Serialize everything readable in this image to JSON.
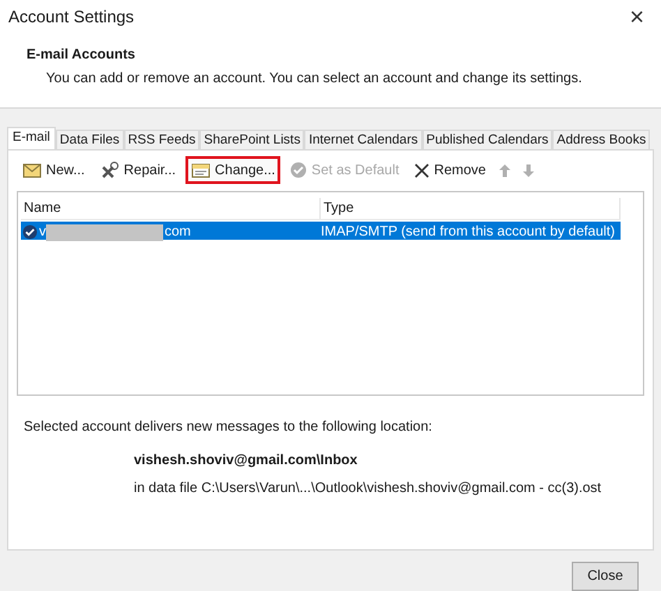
{
  "window": {
    "title": "Account Settings",
    "close_glyph": "×"
  },
  "header": {
    "title": "E-mail Accounts",
    "description": "You can add or remove an account. You can select an account and change its settings."
  },
  "tabs": [
    {
      "label": "E-mail",
      "selected": true
    },
    {
      "label": "Data Files",
      "selected": false
    },
    {
      "label": "RSS Feeds",
      "selected": false
    },
    {
      "label": "SharePoint Lists",
      "selected": false
    },
    {
      "label": "Internet Calendars",
      "selected": false
    },
    {
      "label": "Published Calendars",
      "selected": false
    },
    {
      "label": "Address Books",
      "selected": false
    }
  ],
  "toolbar": [
    {
      "kind": "new",
      "label": "New...",
      "disabled": false,
      "highlighted": false
    },
    {
      "kind": "repair",
      "label": "Repair...",
      "disabled": false,
      "highlighted": false
    },
    {
      "kind": "change",
      "label": "Change...",
      "disabled": false,
      "highlighted": true
    },
    {
      "kind": "default",
      "label": "Set as Default",
      "disabled": true,
      "highlighted": false
    },
    {
      "kind": "remove",
      "label": "Remove",
      "disabled": false,
      "highlighted": false
    },
    {
      "kind": "up",
      "disabled": true
    },
    {
      "kind": "down",
      "disabled": true
    }
  ],
  "table": {
    "columns": [
      "Name",
      "Type"
    ],
    "rows": [
      {
        "name_start": "v",
        "name_end": "com",
        "redacted": true,
        "type": "IMAP/SMTP (send from this account by default)",
        "selected": true,
        "default": true
      }
    ]
  },
  "delivery": {
    "intro": "Selected account delivers new messages to the following location:",
    "folder": "vishesh.shoviv@gmail.com\\Inbox",
    "data_file": "in data file C:\\Users\\Varun\\...\\Outlook\\vishesh.shoviv@gmail.com - cc(3).ost"
  },
  "buttons": [
    {
      "label": "Close"
    }
  ]
}
